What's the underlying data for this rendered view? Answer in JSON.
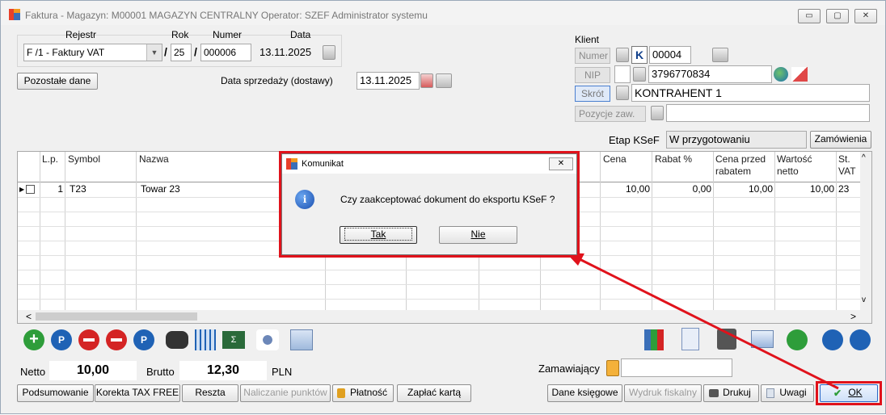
{
  "window": {
    "title": "Faktura - Magazyn: M00001 MAGAZYN CENTRALNY  Operator: SZEF Administrator systemu",
    "minimize": "▭",
    "restore": "▢",
    "close": "✕"
  },
  "header": {
    "rejestr_label": "Rejestr",
    "rok_label": "Rok",
    "numer_label": "Numer",
    "data_label": "Data",
    "rejestr_value": "F /1   - Faktury VAT",
    "sep1": "/",
    "rok_value": "25",
    "sep2": "/",
    "numer_value": "000006",
    "data_value": "13.11.2025",
    "pozostale_button": "Pozostałe dane",
    "data_sprzedazy_label": "Data sprzedaży (dostawy)",
    "data_sprzedazy_value": "13.11.2025"
  },
  "client": {
    "section_label": "Klient",
    "numer_button": "Numer",
    "k_badge": "K",
    "numer_value": "00004",
    "nip_button": "NIP",
    "nip_value": "3796770834",
    "skrot_button": "Skrót",
    "skrot_value": "KONTRAHENT 1",
    "pozycje_button": "Pozycje zaw.",
    "pozycje_value": "",
    "etap_label": "Etap KSeF",
    "etap_value": "W przygotowaniu",
    "zamowienia_button": "Zamówienia"
  },
  "grid": {
    "columns": [
      "L.p.",
      "Symbol",
      "Nazwa",
      "Cena",
      "Rabat %",
      "Cena przed rabatem",
      "Wartość netto",
      "St. VAT"
    ],
    "rows": [
      {
        "lp": "1",
        "symbol": "T23",
        "nazwa": "Towar 23",
        "cena": "10,00",
        "rabat": "0,00",
        "cena_przed": "10,00",
        "wartosc": "10,00",
        "vat": "23"
      }
    ],
    "scroll_left": "<",
    "scroll_right": ">",
    "scroll_up": "^",
    "scroll_down": "v"
  },
  "totals": {
    "netto_label": "Netto",
    "netto_value": "10,00",
    "brutto_label": "Brutto",
    "brutto_value": "12,30",
    "currency": "PLN",
    "zamawiajacy_label": "Zamawiający",
    "zamawiajacy_value": ""
  },
  "bottom_buttons": {
    "podsumowanie": "Podsumowanie",
    "korekta": "Korekta TAX FREE",
    "reszta": "Reszta",
    "naliczanie": "Naliczanie punktów",
    "platnosc": "Płatność",
    "zaplac": "Zapłać kartą",
    "dane_ksiegowe": "Dane księgowe",
    "wydruk": "Wydruk fiskalny",
    "drukuj": "Drukuj",
    "uwagi": "Uwagi",
    "ok": "OK"
  },
  "dialog": {
    "title": "Komunikat",
    "close": "✕",
    "info_glyph": "i",
    "message": "Czy zaakceptować dokument do eksportu KSeF ?",
    "tak": "Tak",
    "nie": "Nie"
  },
  "colors": {
    "highlight_red": "#e0121b",
    "accent_blue": "#1f62b5",
    "add_green": "#2e9d3a",
    "remove_red": "#d42424"
  }
}
